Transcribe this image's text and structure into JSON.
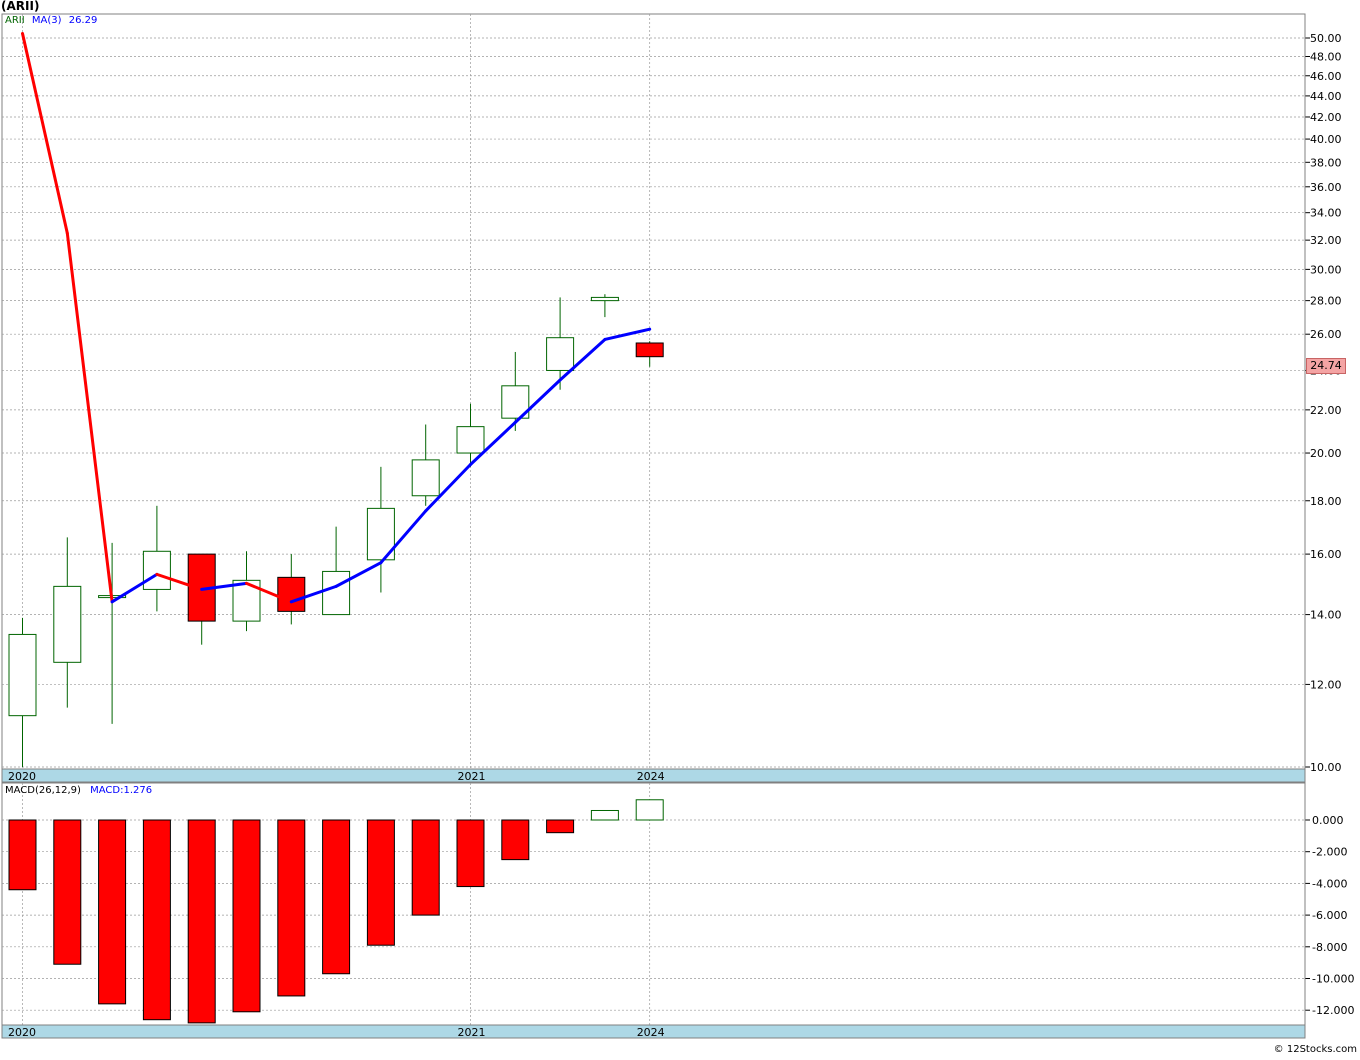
{
  "symbol_label": "(ARII)",
  "price_legend": {
    "symbol": "ARII",
    "ma_label": "MA(3)",
    "ma_value": "26.29"
  },
  "macd_legend": {
    "label": "MACD(26,12,9)",
    "value_label": "MACD:1.276"
  },
  "last_price_tag": "24.74",
  "credit": "© 12Stocks.com",
  "colors": {
    "up": "#006400",
    "down": "#ff0000",
    "ma_up": "#0000ff",
    "ma_down": "#ff0000",
    "date_bar": "#add8e6"
  },
  "chart_data": [
    {
      "type": "candlestick",
      "title": "(ARII)",
      "y_scale": "log",
      "ylim": [
        9.9,
        52
      ],
      "y_ticks": [
        "10.00",
        "12.00",
        "14.00",
        "16.00",
        "18.00",
        "20.00",
        "22.00",
        "24.00",
        "26.00",
        "28.00",
        "30.00",
        "32.00",
        "34.00",
        "36.00",
        "38.00",
        "40.00",
        "42.00",
        "44.00",
        "46.00",
        "48.00",
        "50.00"
      ],
      "x_tick_labels": [
        "2020",
        "2021",
        "2024"
      ],
      "grid": true,
      "candles": [
        {
          "open": 11.2,
          "high": 13.9,
          "low": 10.0,
          "close": 13.4
        },
        {
          "open": 12.6,
          "high": 16.6,
          "low": 11.4,
          "close": 14.9
        },
        {
          "open": 14.6,
          "high": 16.4,
          "low": 11.0,
          "close": 14.6
        },
        {
          "open": 14.8,
          "high": 17.8,
          "low": 14.1,
          "close": 16.1
        },
        {
          "open": 16.0,
          "high": 16.0,
          "low": 13.1,
          "close": 13.8
        },
        {
          "open": 13.8,
          "high": 16.1,
          "low": 13.5,
          "close": 15.1
        },
        {
          "open": 15.2,
          "high": 16.0,
          "low": 13.7,
          "close": 14.1
        },
        {
          "open": 14.0,
          "high": 17.0,
          "low": 14.0,
          "close": 15.4
        },
        {
          "open": 15.8,
          "high": 19.4,
          "low": 14.7,
          "close": 17.7
        },
        {
          "open": 18.2,
          "high": 21.3,
          "low": 17.8,
          "close": 19.7
        },
        {
          "open": 20.0,
          "high": 22.3,
          "low": 19.4,
          "close": 21.2
        },
        {
          "open": 21.6,
          "high": 25.0,
          "low": 21.0,
          "close": 23.2
        },
        {
          "open": 24.0,
          "high": 28.2,
          "low": 23.0,
          "close": 25.8
        },
        {
          "open": 28.0,
          "high": 28.4,
          "low": 27.0,
          "close": 28.2
        },
        {
          "open": 25.5,
          "high": 25.6,
          "low": 24.2,
          "close": 24.74
        }
      ],
      "ma_series": {
        "name": "MA(3)",
        "values": [
          50.5,
          32.5,
          14.4,
          15.3,
          14.8,
          15.0,
          14.4,
          14.9,
          15.7,
          17.6,
          19.5,
          21.4,
          23.5,
          25.7,
          26.29
        ]
      }
    },
    {
      "type": "bar",
      "title": "MACD(26,12,9)",
      "ylim": [
        -12.8,
        1.8
      ],
      "y_ticks": [
        "0.000",
        "-2.000",
        "-4.000",
        "-6.000",
        "-8.000",
        "-10.000",
        "-12.000"
      ],
      "x_tick_labels": [
        "2020",
        "2021",
        "2024"
      ],
      "values": [
        -4.4,
        -9.1,
        -11.6,
        -12.6,
        -12.8,
        -12.1,
        -11.1,
        -9.7,
        -7.9,
        -6.0,
        -4.2,
        -2.5,
        -0.8,
        0.6,
        1.276
      ]
    }
  ]
}
